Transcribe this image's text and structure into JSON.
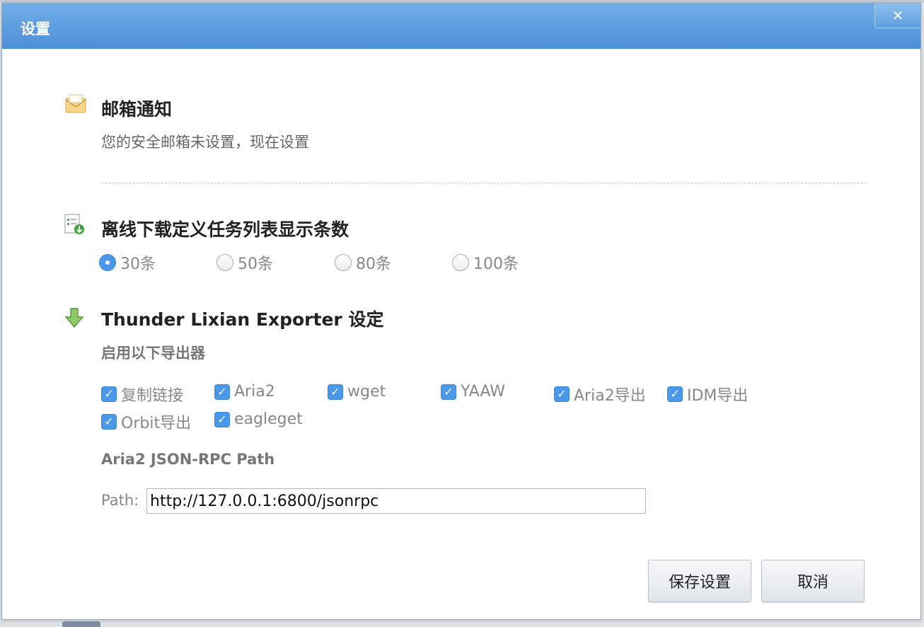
{
  "dialog": {
    "title": "设置",
    "close_label": "✕"
  },
  "email_section": {
    "title": "邮箱通知",
    "description": "您的安全邮箱未设置，现在设置"
  },
  "offline_section": {
    "title": "离线下载定义任务列表显示条数",
    "options": [
      "30条",
      "50条",
      "80条",
      "100条"
    ],
    "selected": "30条"
  },
  "exporter_section": {
    "title": "Thunder Lixian Exporter 设定",
    "subtitle": "启用以下导出器",
    "exporters": [
      {
        "label": "复制链接",
        "checked": true
      },
      {
        "label": "Aria2",
        "checked": true
      },
      {
        "label": "wget",
        "checked": true
      },
      {
        "label": "YAAW",
        "checked": true
      },
      {
        "label": "Aria2导出",
        "checked": true
      },
      {
        "label": "IDM导出",
        "checked": true
      },
      {
        "label": "Orbit导出",
        "checked": true
      },
      {
        "label": "eagleget",
        "checked": true
      }
    ],
    "rpc_heading": "Aria2 JSON-RPC Path",
    "path_label": "Path:",
    "path_value": "http://127.0.0.1:6800/jsonrpc"
  },
  "buttons": {
    "save": "保存设置",
    "cancel": "取消"
  },
  "colors": {
    "titlebar": "#5a9be0",
    "accent": "#4a98ea"
  }
}
